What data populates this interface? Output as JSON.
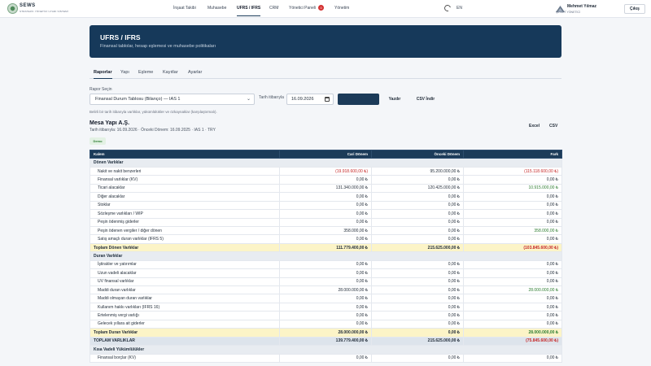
{
  "brand": {
    "name": "SEWS",
    "subtitle": "STRATEJİK YÖNETİCİ UYARI SİSTEMİ"
  },
  "nav": {
    "items": [
      {
        "label": "İnşaat Takibi"
      },
      {
        "label": "Muhasebe"
      },
      {
        "label": "UFRS / IFRS"
      },
      {
        "label": "CRM"
      },
      {
        "label": "Yönetici Paneli",
        "badge": "0"
      },
      {
        "label": "Yönetim"
      }
    ],
    "lang": "EN",
    "user_name": "Mehmet Yılmaz",
    "user_role": "ŞİRKET YÖNETİCİ",
    "logout": "Çıkış"
  },
  "hero": {
    "title": "UFRS / IFRS",
    "subtitle": "Finansal tablolar, hesap eşlemesi ve muhasebe politikaları"
  },
  "tabs": [
    "Raporlar",
    "Yapı",
    "Eşleme",
    "Kayıtlar",
    "Ayarlar"
  ],
  "controls": {
    "report_label": "Rapor Seçin",
    "report_value": "Finansal Durum Tablosu (Bilanço) — IAS 1",
    "date_label": "Tarih itibarıyla",
    "date_value": "16.09.2026",
    "generate_label": "Rapor Oluştur",
    "print_label": "Yazdır",
    "csv_download_label": "CSV İndir",
    "hint": "Belirli bir tarih itibarıyla varlıklar, yükümlülükler ve özkaynaklar (karşılaştırmalı)."
  },
  "report": {
    "company": "Mesa Yapı A.Ş.",
    "meta": "Tarih itibarıyla: 16.09.2026 · Önceki Dönem: 16.09.2025 · IAS 1 · TRY",
    "excel_label": "Excel",
    "csv_label": "CSV",
    "demo_label": "Demo"
  },
  "table": {
    "headers": [
      "Kalem",
      "Cari Dönem",
      "Önceki Dönem",
      "Fark"
    ],
    "rows": [
      {
        "type": "section",
        "label": "Dönen Varlıklar"
      },
      {
        "type": "row",
        "label": "Nakit ve nakit benzerleri",
        "cur": "(19.918.600,00 ₺)",
        "prev": "95.200.000,00 ₺",
        "diff": "(115.118.600,00 ₺)",
        "cur_tone": "neg",
        "diff_tone": "neg"
      },
      {
        "type": "row",
        "label": "Finansal varlıklar (KV)",
        "cur": "0,00 ₺",
        "prev": "0,00 ₺",
        "diff": "0,00 ₺"
      },
      {
        "type": "row",
        "label": "Ticari alacaklar",
        "cur": "131.340.000,00 ₺",
        "prev": "120.425.000,00 ₺",
        "diff": "10.915.000,00 ₺",
        "diff_tone": "pos"
      },
      {
        "type": "row",
        "label": "Diğer alacaklar",
        "cur": "0,00 ₺",
        "prev": "0,00 ₺",
        "diff": "0,00 ₺"
      },
      {
        "type": "row",
        "label": "Stoklar",
        "cur": "0,00 ₺",
        "prev": "0,00 ₺",
        "diff": "0,00 ₺"
      },
      {
        "type": "row",
        "label": "Sözleşme varlıkları / WIP",
        "cur": "0,00 ₺",
        "prev": "0,00 ₺",
        "diff": "0,00 ₺"
      },
      {
        "type": "row",
        "label": "Peşin ödenmiş giderler",
        "cur": "0,00 ₺",
        "prev": "0,00 ₺",
        "diff": "0,00 ₺"
      },
      {
        "type": "row",
        "label": "Peşin ödenen vergiler / diğer dönen",
        "cur": "358.000,00 ₺",
        "prev": "0,00 ₺",
        "diff": "358.000,00 ₺",
        "diff_tone": "pos"
      },
      {
        "type": "row",
        "label": "Satış amaçlı duran varlıklar (IFRS 5)",
        "cur": "0,00 ₺",
        "prev": "0,00 ₺",
        "diff": "0,00 ₺"
      },
      {
        "type": "total",
        "label": "Toplam Dönen Varlıklar",
        "cur": "111.779.400,00 ₺",
        "prev": "215.625.000,00 ₺",
        "diff": "(103.845.600,00 ₺)",
        "diff_tone": "neg"
      },
      {
        "type": "section",
        "label": "Duran Varlıklar"
      },
      {
        "type": "row",
        "label": "İştirakler ve yatırımlar",
        "cur": "0,00 ₺",
        "prev": "0,00 ₺",
        "diff": "0,00 ₺"
      },
      {
        "type": "row",
        "label": "Uzun vadeli alacaklar",
        "cur": "0,00 ₺",
        "prev": "0,00 ₺",
        "diff": "0,00 ₺"
      },
      {
        "type": "row",
        "label": "UV finansal varlıklar",
        "cur": "0,00 ₺",
        "prev": "0,00 ₺",
        "diff": "0,00 ₺"
      },
      {
        "type": "row",
        "label": "Maddi duran varlıklar",
        "cur": "28.000.000,00 ₺",
        "prev": "0,00 ₺",
        "diff": "28.000.000,00 ₺",
        "diff_tone": "pos"
      },
      {
        "type": "row",
        "label": "Maddi olmayan duran varlıklar",
        "cur": "0,00 ₺",
        "prev": "0,00 ₺",
        "diff": "0,00 ₺"
      },
      {
        "type": "row",
        "label": "Kullanım hakkı varlıkları (IFRS 16)",
        "cur": "0,00 ₺",
        "prev": "0,00 ₺",
        "diff": "0,00 ₺"
      },
      {
        "type": "row",
        "label": "Ertelenmiş vergi varlığı",
        "cur": "0,00 ₺",
        "prev": "0,00 ₺",
        "diff": "0,00 ₺"
      },
      {
        "type": "row",
        "label": "Gelecek yıllara ait giderler",
        "cur": "0,00 ₺",
        "prev": "0,00 ₺",
        "diff": "0,00 ₺"
      },
      {
        "type": "total",
        "label": "Toplam Duran Varlıklar",
        "cur": "28.000.000,00 ₺",
        "prev": "0,00 ₺",
        "diff": "28.000.000,00 ₺",
        "diff_tone": "pos"
      },
      {
        "type": "grand",
        "label": "TOPLAM VARLIKLAR",
        "cur": "139.779.400,00 ₺",
        "prev": "215.625.000,00 ₺",
        "diff": "(75.845.600,00 ₺)",
        "diff_tone": "neg"
      },
      {
        "type": "section",
        "label": "Kısa Vadeli Yükümlülükler"
      },
      {
        "type": "row",
        "label": "Finansal borçlar (KV)",
        "cur": "0,00 ₺",
        "prev": "0,00 ₺",
        "diff": "0,00 ₺"
      }
    ]
  }
}
